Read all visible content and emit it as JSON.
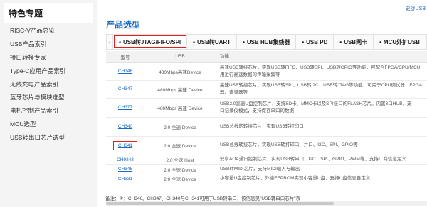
{
  "sidebar": {
    "title": "特色专题",
    "items": [
      "RISC-V产品总览",
      "USB产品索引",
      "接口转换专家",
      "Type-C应用产品索引",
      "无线充电产品索引",
      "蓝牙芯片与模块选型",
      "电机控制产品索引",
      "MCU选型",
      "USB转串口芯片选型"
    ]
  },
  "header": {
    "top_right_link": "史@USB"
  },
  "section_title": "产品选型",
  "tabs": {
    "prev_arrow": "‹",
    "items": [
      "USB转JTAG/FIFO/SPI",
      "USB转UART",
      "USB HUB集线器",
      "USB PD",
      "USB网卡",
      "MCU外扩USB"
    ]
  },
  "table": {
    "headers": {
      "model": "型号",
      "usb": "USB",
      "func": "功能"
    },
    "rows": [
      {
        "model": "CH346",
        "usb": "480Mbps高速Device",
        "func": [
          "高速USB转接芯片，实现USB转FIFO、USB转SPI、USB转GPIO等功能，可配合FPGA/CPU/MCU",
          "用进行高速数据的传输采集等"
        ]
      },
      {
        "model": "CH347",
        "usb": "480Mbps 高速 Device",
        "func": [
          "高速USB转接芯片，实现USB转SPI、USB转I2C、USB转JTAG等功能，可用于CPU调试器、FPGA",
          "器、烧录器等"
        ]
      },
      {
        "model": "CH377",
        "usb": "480Mbps 高速 Device",
        "func": [
          "USB2.0高速U盘控制芯片，支持SD卡、MMC卡以及SPI接口的FLASH芯片。内置3口HUB，支",
          "口记录仪模式，支持保存串口的数据"
        ]
      },
      {
        "model": "CH340",
        "usb": "2.0 全速 Device",
        "func": [
          "USB总线的转接芯片，实现USB转打印口"
        ]
      },
      {
        "model": "CH341",
        "usb": "2.0 全速 Device",
        "func": [
          "USB总线转接芯片，实现USB转打印口、并口、I2C、SPI、GPIO等"
        ]
      },
      {
        "model": "CH9343",
        "usb": "2.0 全速 Host",
        "func": [
          "安卓AOA通讯控制芯片，实现USB转串口、I2C、SPI、GPIO、PWM等，支持厂商信息定义"
        ]
      },
      {
        "model": "CH345",
        "usb": "2.0 全速 Device",
        "func": [
          "USB转MIDI芯片，支持MIDI输入与输出"
        ]
      },
      {
        "model": "CH331",
        "usb": "2.0 全速 Device",
        "func": [
          "小容量U盘控制芯片，外接EEPROM实现小容量U盘，支持U盘信息自定义"
        ]
      }
    ]
  },
  "note": "备注：①：CH346、CH347、CH340与CH341可用于USB转串口，该信息见\"USB转串口芯片\"表"
}
